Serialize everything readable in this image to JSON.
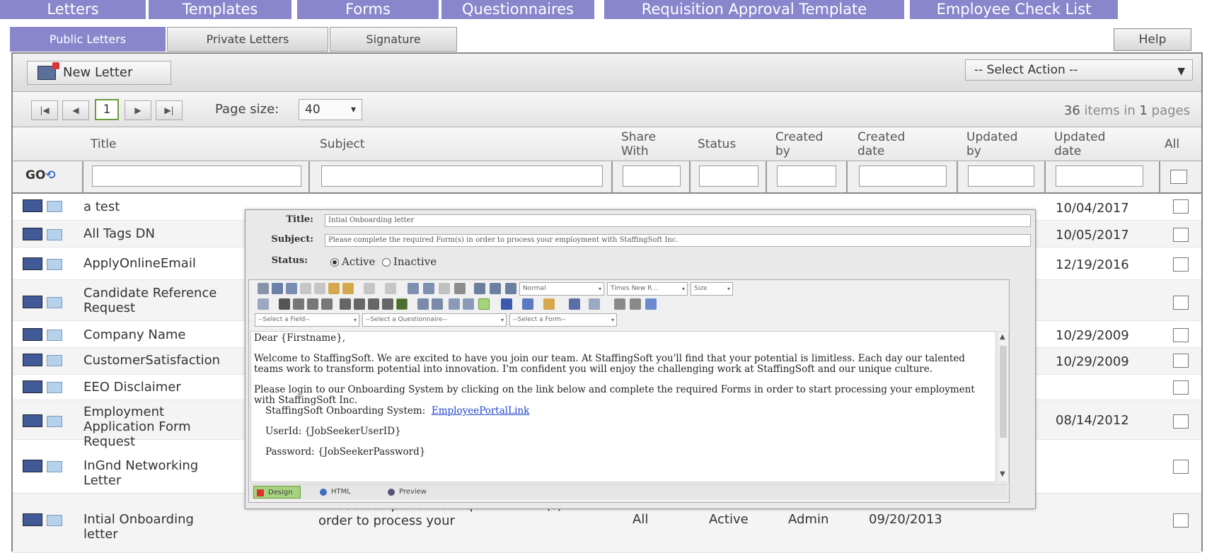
{
  "topnav": [
    "Letters",
    "Templates",
    "Forms",
    "Questionnaires",
    "Requisition Approval Template",
    "Employee Check List"
  ],
  "subtabs": [
    "Public Letters",
    "Private Letters",
    "Signature"
  ],
  "help": "Help",
  "toolbar": {
    "new_letter": "New Letter",
    "select_action": "-- Select Action --"
  },
  "pager": {
    "page": "1",
    "page_size_label": "Page size:",
    "page_size": "40",
    "items_count": "36",
    "items_mid": "items in",
    "pages_count": "1",
    "pages_word": "pages"
  },
  "columns": {
    "title": "Title",
    "subject": "Subject",
    "share_with": "Share With",
    "status": "Status",
    "created_by": "Created by",
    "created_date": "Created date",
    "updated_by": "Updated by",
    "updated_date": "Updated date",
    "all": "All"
  },
  "filter": {
    "go": "GO"
  },
  "rows": [
    {
      "title": "a test",
      "updated_date": "10/04/2017"
    },
    {
      "title": "All Tags DN",
      "updated_date": "10/05/2017"
    },
    {
      "title": "ApplyOnlineEmail",
      "updated_date": "12/19/2016"
    },
    {
      "title": "Candidate Reference Request",
      "updated_date": ""
    },
    {
      "title": "Company Name",
      "updated_date": "10/29/2009"
    },
    {
      "title": "CustomerSatisfaction",
      "updated_date": "10/29/2009"
    },
    {
      "title": "EEO Disclaimer",
      "updated_date": ""
    },
    {
      "title": "Employment Application Form Request",
      "updated_date": "08/14/2012"
    },
    {
      "title": "InGnd Networking Letter",
      "updated_date": ""
    },
    {
      "title": "Intial Onboarding letter",
      "subject": "Please complete the required Form (s) in order to process your",
      "share_with": "All",
      "status": "Active",
      "created_by": "Admin",
      "created_date": "09/20/2013",
      "updated_date": ""
    }
  ],
  "dialog": {
    "title_label": "Title:",
    "title_value": "Intial Onboarding letter",
    "subject_label": "Subject:",
    "subject_value": "Please complete the required Form(s) in order to process your employment with StaffingSoft Inc.",
    "status_label": "Status:",
    "active": "Active",
    "inactive": "Inactive",
    "format": "Normal",
    "font": "Times New R...",
    "size": "Size",
    "select_field": "--Select a Field--",
    "select_questionnaire": "--Select a Questionnaire--",
    "select_form": "--Select a Form--",
    "body": {
      "greeting": "Dear {Firstname},",
      "para1": "Welcome to StaffingSoft. We are excited to have you join our team.  At StaffingSoft you'll find that your potential is limitless.  Each day our talented teams work to transform potential into innovation.  I'm confident you will enjoy the challenging work at StaffingSoft and our unique culture.",
      "para2": "Please login to our Onboarding System by clicking on the link below and complete the required Forms in order to start processing your employment with StaffingSoft Inc.",
      "system_label": "StaffingSoft Onboarding System:",
      "system_link": "EmployeePortalLink",
      "userid": "UserId: {JobSeekerUserID}",
      "password": "Password: {JobSeekerPassword}"
    },
    "modes": [
      "Design",
      "HTML",
      "Preview"
    ]
  },
  "colors": {
    "accent": "#8a86cc",
    "go_green": "#6b9b3a"
  }
}
